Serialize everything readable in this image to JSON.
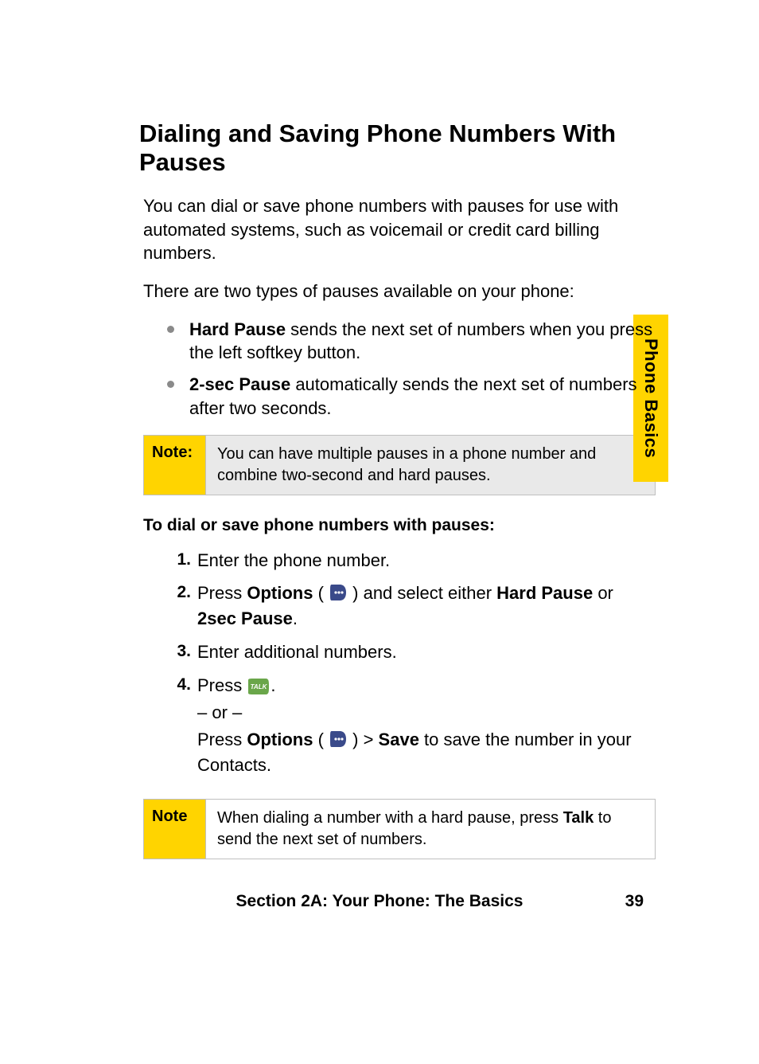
{
  "sideTab": "Phone Basics",
  "heading": "Dialing and Saving Phone Numbers With Pauses",
  "intro1": "You can dial or save phone numbers with pauses for use with automated systems, such as voicemail or credit card billing numbers.",
  "intro2": "There are two types of pauses available on your phone:",
  "bullets": {
    "b1": {
      "lead": "Hard Pause",
      "rest": " sends the next set of numbers when you press the left softkey button."
    },
    "b2": {
      "lead": "2-sec Pause",
      "rest": " automatically sends the next set of numbers after two seconds."
    }
  },
  "note1": {
    "label": "Note:",
    "content": "You can have multiple pauses in a phone number and combine two-second and hard pauses."
  },
  "subhead": "To dial or save phone numbers with pauses:",
  "steps": {
    "s1": "Enter the phone number.",
    "s2": {
      "press": "Press ",
      "options": "Options",
      "paren_open": " ( ",
      "paren_close": " ) and select either ",
      "hp": "Hard Pause",
      "or": " or ",
      "tp": "2sec Pause",
      "period": "."
    },
    "s3": "Enter additional numbers.",
    "s4": {
      "press": "Press ",
      "period": ".",
      "or": "– or –",
      "press2": "Press ",
      "options": "Options",
      "paren_open": " ( ",
      "paren_close": " ) > ",
      "save": "Save",
      "rest": " to save the number in your Contacts."
    }
  },
  "note2": {
    "label": "Note",
    "pre": "When dialing a number with a hard pause, press ",
    "talk": "Talk",
    "post": " to send the next set of numbers."
  },
  "footer": {
    "section": "Section 2A: Your Phone: The Basics",
    "page": "39"
  }
}
